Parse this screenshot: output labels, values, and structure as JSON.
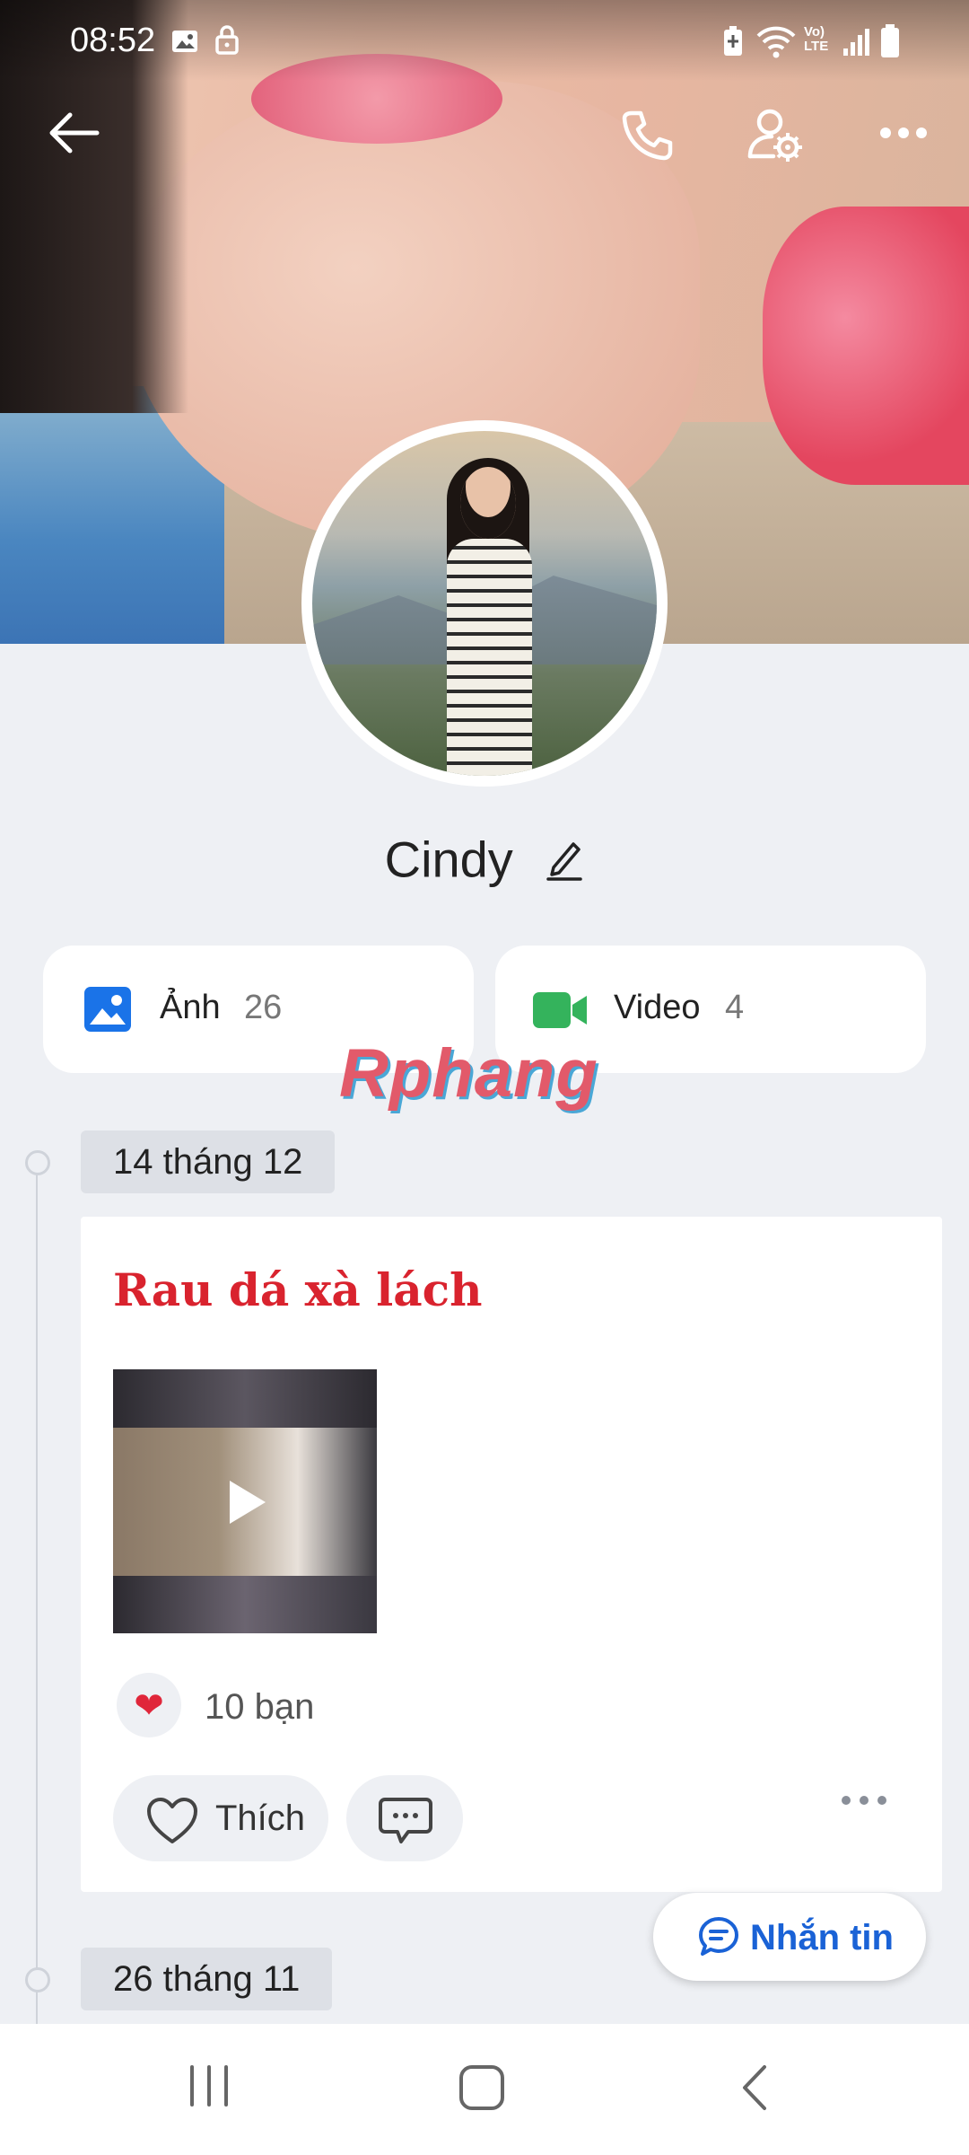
{
  "status_bar": {
    "time": "08:52",
    "icons": [
      "image-icon",
      "lock-icon",
      "battery-saver-icon",
      "wifi-icon",
      "volte-icon",
      "signal-icon",
      "battery-icon"
    ],
    "volte_text": "Vo) LTE"
  },
  "header": {
    "back_icon": "arrow-left-icon",
    "call_icon": "phone-icon",
    "profile_settings_icon": "user-settings-icon",
    "more_icon": "more-horizontal-icon"
  },
  "profile": {
    "name": "Cindy",
    "edit_icon": "pencil-icon"
  },
  "media": {
    "photos": {
      "label": "Ảnh",
      "count": "26",
      "icon": "photo-icon",
      "color": "#1a73e8"
    },
    "videos": {
      "label": "Video",
      "count": "4",
      "icon": "video-camera-icon",
      "color": "#34b35c"
    }
  },
  "watermark": "Rphang",
  "timeline": [
    {
      "date": "14 tháng 12",
      "post": {
        "title": "Rau dá xà lách",
        "title_color": "#d9232e",
        "has_video": true,
        "reactions": {
          "icon": "heart-icon",
          "text": "10 bạn"
        },
        "like_label": "Thích"
      }
    },
    {
      "date": "26 tháng 11"
    }
  ],
  "message_button": {
    "label": "Nhắn tin",
    "color": "#1a62d6"
  },
  "nav_bar": [
    "recent-apps-icon",
    "home-icon",
    "back-icon"
  ]
}
